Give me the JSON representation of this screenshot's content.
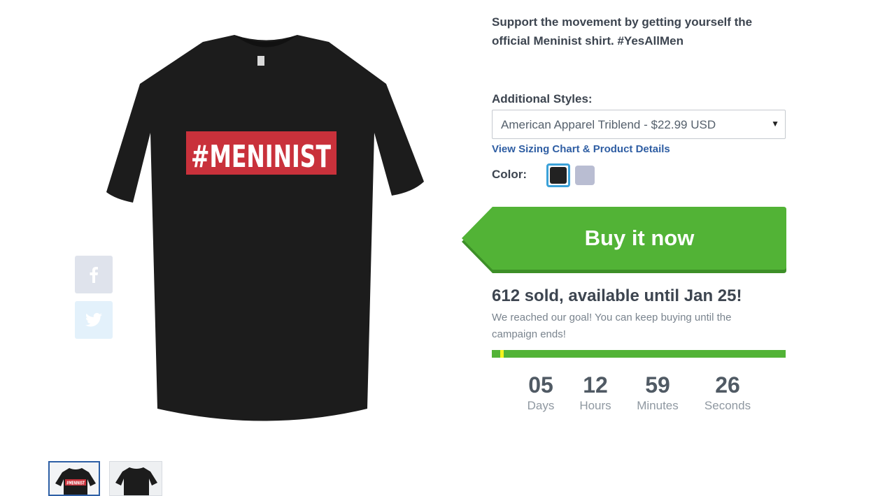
{
  "product": {
    "shirt_print": "#MENINIST",
    "colors": {
      "shirt": "#1c1c1c",
      "print_bg": "#c9313b",
      "print_text": "#ffffff"
    }
  },
  "share": {
    "facebook_icon": "facebook-icon",
    "twitter_icon": "twitter-icon"
  },
  "description": "Support the movement by getting yourself the official Meninist shirt. #YesAllMen",
  "styles": {
    "label": "Additional Styles:",
    "selected": "American Apparel Triblend - $22.99 USD"
  },
  "sizing_link": "View Sizing Chart & Product Details",
  "color": {
    "label": "Color:",
    "swatches": [
      {
        "name": "black",
        "hex": "#222222",
        "selected": true
      },
      {
        "name": "gray",
        "hex": "#b9bdd2",
        "selected": false
      }
    ]
  },
  "buy": {
    "label": "Buy it now",
    "color": "#52b336",
    "shadow": "#3d8f28"
  },
  "sales": {
    "headline": "612 sold, available until Jan 25!",
    "note": "We reached our goal! You can keep buying until the campaign ends!",
    "progress_marker_fraction": 0.07
  },
  "countdown": [
    {
      "value": "05",
      "unit": "Days"
    },
    {
      "value": "12",
      "unit": "Hours"
    },
    {
      "value": "59",
      "unit": "Minutes"
    },
    {
      "value": "26",
      "unit": "Seconds"
    }
  ]
}
